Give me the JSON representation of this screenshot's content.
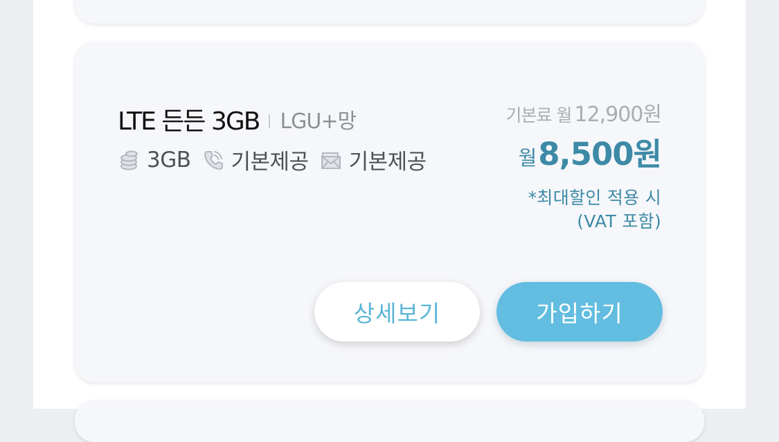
{
  "plan": {
    "name": "LTE 든든 3GB",
    "network": "LGU+망",
    "features": [
      {
        "icon": "data-stack-icon",
        "text": "3GB"
      },
      {
        "icon": "phone-call-icon",
        "text": "기본제공"
      },
      {
        "icon": "message-envelope-icon",
        "text": "기본제공"
      }
    ],
    "base_label": "기본료 월",
    "base_price": "12,900원",
    "sale_prefix": "월",
    "sale_price": "8,500원",
    "note_line1": "*최대할인 적용 시",
    "note_line2": "(VAT 포함)"
  },
  "buttons": {
    "detail_label": "상세보기",
    "join_label": "가입하기"
  },
  "colors": {
    "accent": "#3d8aa6",
    "button_primary": "#62bde0",
    "button_secondary_text": "#5bb6d6"
  }
}
